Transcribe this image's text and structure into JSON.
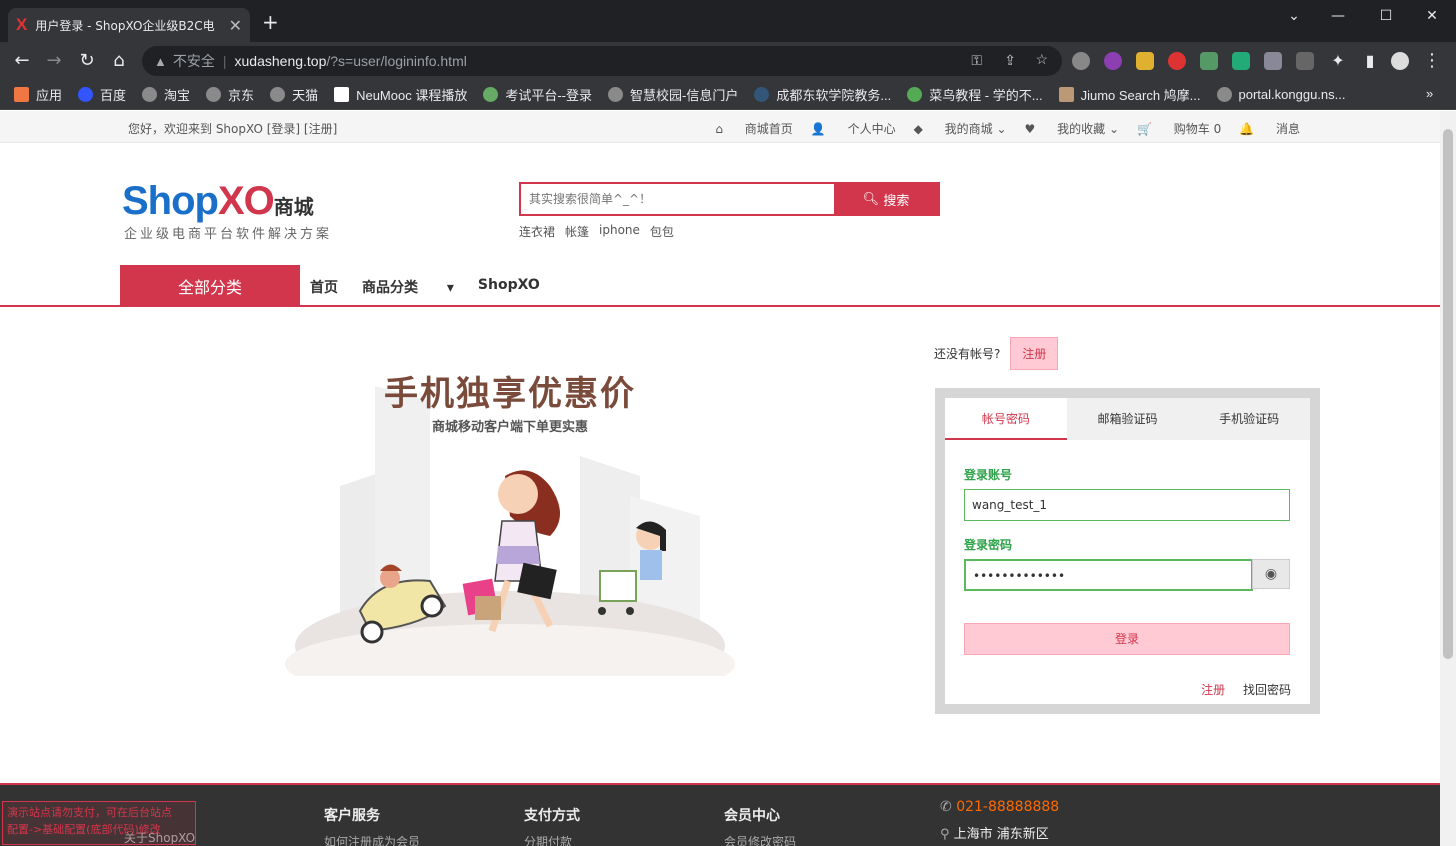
{
  "browser": {
    "tab_title": "用户登录 - ShopXO企业级B2C电",
    "tab_favicon": "X",
    "url_security": "不安全",
    "url_domain": "xudasheng.top",
    "url_path": "/?s=user/logininfo.html",
    "bookmarks": [
      "应用",
      "百度",
      "淘宝",
      "京东",
      "天猫",
      "NeuMooc 课程播放",
      "考试平台--登录",
      "智慧校园-信息门户",
      "成都东软学院教务...",
      "菜鸟教程 - 学的不...",
      "Jiumo Search 鸠摩...",
      "portal.konggu.ns..."
    ]
  },
  "topbar": {
    "greeting": "您好，欢迎来到 ShopXO [登录] [注册]",
    "nav": [
      "商城首页",
      "个人中心",
      "我的商城",
      "我的收藏",
      "购物车 0",
      "消息"
    ]
  },
  "header": {
    "logo_shop": "Shop",
    "logo_xo": "XO",
    "logo_mall": "商城",
    "slogan": "企业级电商平台软件解决方案",
    "search_placeholder": "其实搜索很简单^_^！",
    "search_button": "搜索",
    "hot_words": [
      "连衣裙",
      "帐篷",
      "iphone",
      "包包"
    ]
  },
  "nav": {
    "all_categories": "全部分类",
    "items": [
      "首页",
      "商品分类",
      "ShopXO"
    ]
  },
  "promo": {
    "title": "手机独享优惠价",
    "subtitle": "商城移动客户端下单更实惠"
  },
  "login": {
    "no_account": "还没有帐号?",
    "register_button": "注册",
    "tabs": [
      "帐号密码",
      "邮箱验证码",
      "手机验证码"
    ],
    "account_label": "登录账号",
    "account_value": "wang_test_1",
    "password_label": "登录密码",
    "password_value": "•••••••••••••",
    "login_button": "登录",
    "link_register": "注册",
    "link_forgot": "找回密码"
  },
  "footer": {
    "notice_line1": "演示站点请勿支付，可在后台站点",
    "notice_line2": "配置->基础配置(底部代码)修改",
    "col1_sub": "关于ShopXO",
    "col2_title": "客户服务",
    "col2_sub": "如何注册成为会员",
    "col3_title": "支付方式",
    "col3_sub": "分期付款",
    "col4_title": "会员中心",
    "col4_sub": "会员修改密码",
    "phone": "021-88888888",
    "address": "上海市 浦东新区"
  }
}
